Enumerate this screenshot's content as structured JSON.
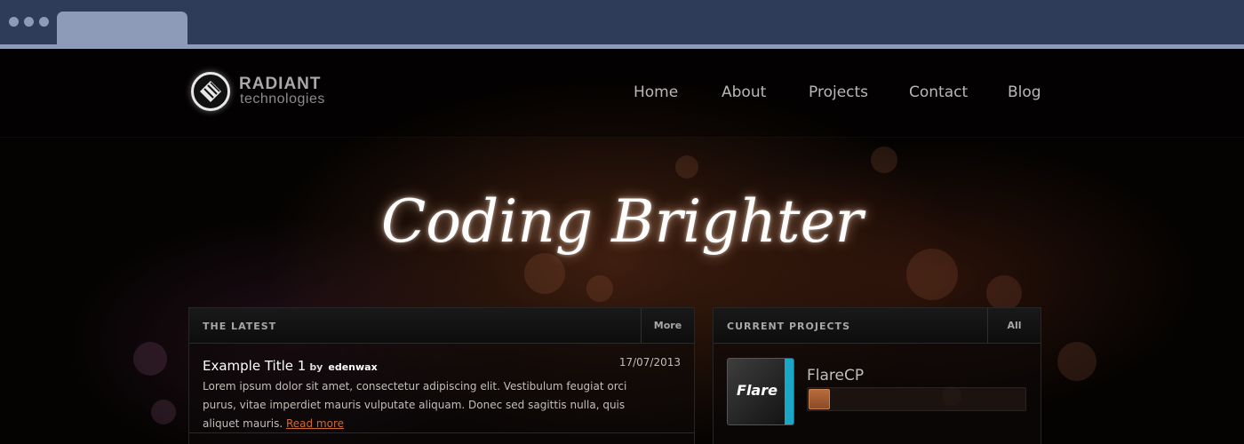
{
  "site": {
    "logo_title": "RADIANT",
    "logo_subtitle": "technologies",
    "nav": [
      "Home",
      "About",
      "Projects",
      "Contact",
      "Blog"
    ],
    "hero_text": "Coding Brighter"
  },
  "latest": {
    "title": "THE LATEST",
    "more_label": "More",
    "posts": [
      {
        "title": "Example Title 1",
        "by": "by",
        "author": "edenwax",
        "date": "17/07/2013",
        "body": "Lorem ipsum dolor sit amet, consectetur adipiscing elit. Vestibulum feugiat orci purus, vitae imperdiet mauris vulputate aliquam. Donec sed sagittis nulla, quis aliquet mauris.",
        "read_more": "Read more"
      }
    ]
  },
  "projects": {
    "title": "CURRENT PROJECTS",
    "all_label": "All",
    "items": [
      {
        "name": "FlareCP",
        "thumb_label": "Flare",
        "progress": 0.1
      }
    ]
  },
  "colors": {
    "chrome": "#2f3c59",
    "chrome_accent": "#8d9bb8",
    "link_accent": "#d06a35",
    "project_stripe": "#19a6c7"
  }
}
